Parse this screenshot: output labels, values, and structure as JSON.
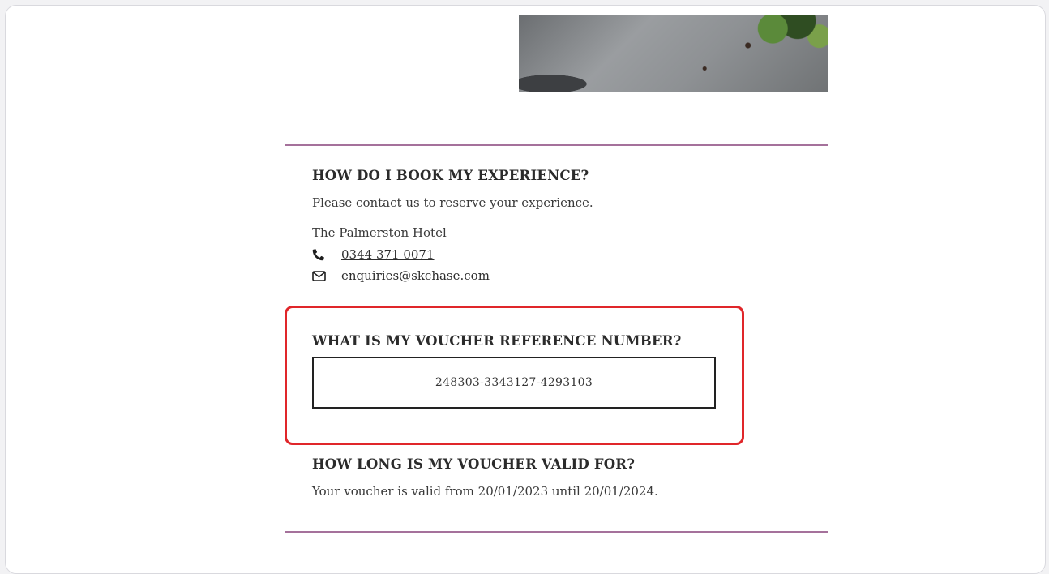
{
  "booking": {
    "heading": "HOW DO I BOOK MY EXPERIENCE?",
    "intro": "Please contact us to reserve your experience.",
    "hotel_name": "The Palmerston Hotel",
    "phone": "0344 371 0071",
    "email": "enquiries@skchase.com"
  },
  "voucher": {
    "heading": "WHAT IS MY VOUCHER REFERENCE NUMBER?",
    "reference": "248303-3343127-4293103"
  },
  "validity": {
    "heading": "HOW LONG IS MY VOUCHER VALID FOR?",
    "text": "Your voucher is valid from 20/01/2023 until 20/01/2024."
  },
  "icons": {
    "phone": "phone-icon",
    "email": "envelope-icon"
  },
  "colors": {
    "divider": "#a5719b",
    "highlight": "#e0262a"
  }
}
